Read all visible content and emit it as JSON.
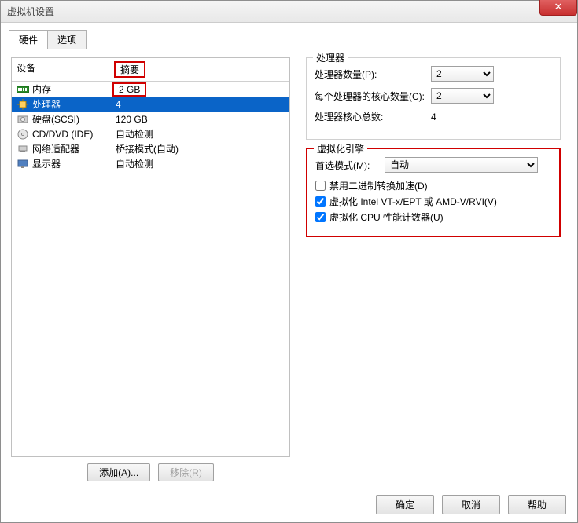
{
  "window": {
    "title": "虚拟机设置"
  },
  "tabs": {
    "hardware": "硬件",
    "options": "选项"
  },
  "hwlist": {
    "header_device": "设备",
    "header_summary": "摘要",
    "rows": [
      {
        "icon": "memory-icon",
        "device": "内存",
        "summary": "2 GB"
      },
      {
        "icon": "cpu-icon",
        "device": "处理器",
        "summary": "4"
      },
      {
        "icon": "disk-icon",
        "device": "硬盘(SCSI)",
        "summary": "120 GB"
      },
      {
        "icon": "cd-icon",
        "device": "CD/DVD (IDE)",
        "summary": "自动检测"
      },
      {
        "icon": "network-icon",
        "device": "网络适配器",
        "summary": "桥接模式(自动)"
      },
      {
        "icon": "monitor-icon",
        "device": "显示器",
        "summary": "自动检测"
      }
    ]
  },
  "buttons": {
    "add": "添加(A)...",
    "remove": "移除(R)"
  },
  "processors": {
    "group_title": "处理器",
    "count_label": "处理器数量(P):",
    "count_value": "2",
    "cores_label": "每个处理器的核心数量(C):",
    "cores_value": "2",
    "total_label": "处理器核心总数:",
    "total_value": "4"
  },
  "engine": {
    "group_title": "虚拟化引擎",
    "mode_label": "首选模式(M):",
    "mode_value": "自动",
    "chk_binary": "禁用二进制转换加速(D)",
    "chk_vtx": "虚拟化 Intel VT-x/EPT 或 AMD-V/RVI(V)",
    "chk_perf": "虚拟化 CPU 性能计数器(U)"
  },
  "footer": {
    "ok": "确定",
    "cancel": "取消",
    "help": "帮助"
  }
}
